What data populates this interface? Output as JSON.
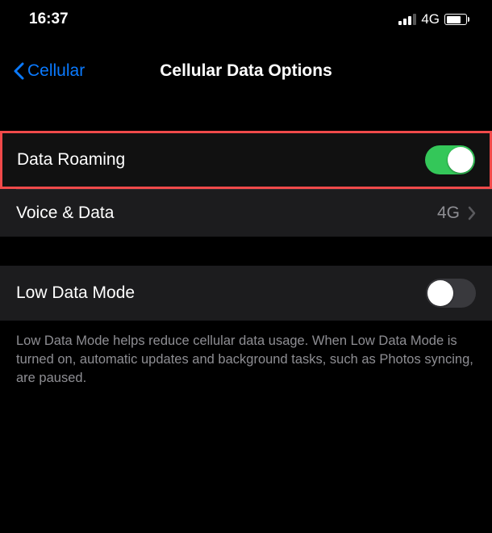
{
  "status": {
    "time": "16:37",
    "network_label": "4G"
  },
  "nav": {
    "back_label": "Cellular",
    "title": "Cellular Data Options"
  },
  "rows": {
    "data_roaming": {
      "label": "Data Roaming",
      "on": true
    },
    "voice_data": {
      "label": "Voice & Data",
      "value": "4G"
    },
    "low_data_mode": {
      "label": "Low Data Mode",
      "on": false
    }
  },
  "footer": {
    "text": "Low Data Mode helps reduce cellular data usage. When Low Data Mode is turned on, automatic updates and background tasks, such as Photos syncing, are paused."
  }
}
